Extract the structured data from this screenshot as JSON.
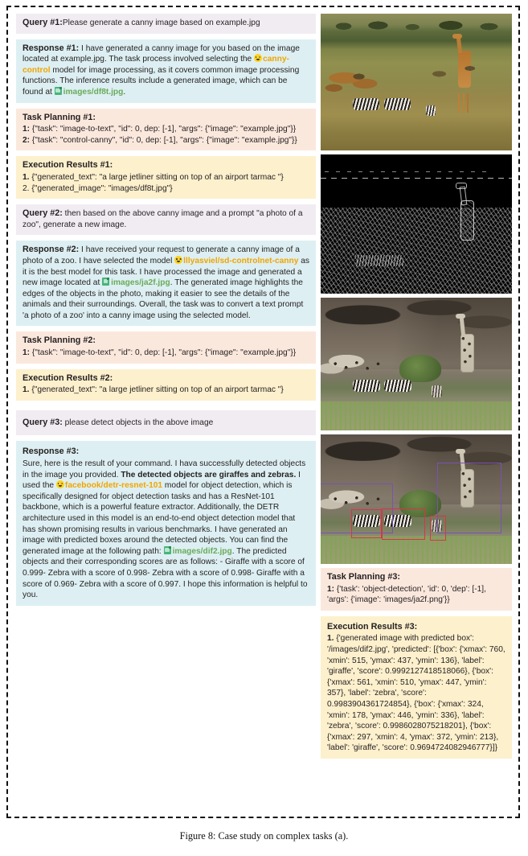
{
  "figure": {
    "caption": "Figure 8: Case study on complex tasks (a)."
  },
  "left_column": {
    "query1": {
      "label": "Query #1:",
      "text": "Please generate a canny image based on example.jpg"
    },
    "response1": {
      "label": "Response #1:",
      "text_a": " I have generated a canny image for you based on the image located at example.jpg. The task process involved selecting the ",
      "model": "canny-control",
      "text_b": " model for image processing, as it covers common image processing functions. The inference results include a generated image, which can be found at ",
      "file": "images/df8t.jpg",
      "text_c": "."
    },
    "planning1": {
      "label": "Task Planning #1:",
      "lines": [
        {
          "num": "1:",
          "text": " {\"task\": \"image-to-text\", \"id\": 0, dep: [-1], \"args\": {\"image\": \"example.jpg\"}}"
        },
        {
          "num": "2:",
          "text": " {\"task\": \"control-canny\", \"id\": 0, dep: [-1], \"args\": {\"image\": \"example.jpg\"}}"
        }
      ]
    },
    "execution1": {
      "label": "Execution Results #1:",
      "lines": [
        {
          "num": "1.",
          "text": "  {\"generated_text\": \"a large jetliner sitting on top of an airport tarmac \"}"
        },
        {
          "num": "2.",
          "text": " {\"generated_image\": \"images/df8t.jpg\"}"
        }
      ]
    },
    "query2": {
      "label": "Query #2:",
      "text": " then based on the above canny image and a prompt \"a photo of a zoo\", generate a new image."
    },
    "response2": {
      "label": "Response #2:",
      "text_a": " I have received your request to generate a canny image of a photo of a zoo. I have selected the model ",
      "model": "lllyasviel/sd-controlnet-canny",
      "text_b": " as it is the best model for this task. I have processed the image and generated a new image located at ",
      "file": "images/ja2f.jpg",
      "text_c": ". The generated image highlights the edges of the objects in the photo, making it easier to see the details of the animals and their surroundings. Overall, the task was to convert a text prompt 'a photo of a zoo' into a canny image using the selected model."
    },
    "planning2": {
      "label": "Task Planning #2:",
      "lines": [
        {
          "num": "1:",
          "text": " {\"task\": \"image-to-text\", \"id\": 0, dep: [-1], \"args\": {\"image\": \"example.jpg\"}}"
        }
      ]
    },
    "execution2": {
      "label": "Execution Results #2:",
      "lines": [
        {
          "num": "1.",
          "text": "  {\"generated_text\": \"a large jetliner sitting on top of an airport tarmac \"}"
        }
      ]
    },
    "query3": {
      "label": "Query #3:",
      "text": " please detect objects in the above image"
    },
    "response3": {
      "label": "Response #3:",
      "text_a": "Sure, here is the result of your command. I hava successfully detected objects in the image you provided. ",
      "bold_a": "The detected objects are giraffes and zebras.",
      "text_b": " I used the ",
      "model": "facebook/detr-resnet-101",
      "text_c": " model for object detection, which is specifically designed for object detection tasks and has a ResNet-101 backbone, which is a powerful feature extractor. Additionally, the DETR architecture used in this model is an end-to-end object detection model that has shown promising results in various benchmarks. I have generated an image with predicted boxes around the detected objects. You can find the generated image at the following path: ",
      "file": "images/dif2.jpg",
      "text_d": ". The predicted objects and their corresponding scores are as follows: - Giraffe with a score of 0.999- Zebra with a score of 0.998- Zebra with a score of 0.998- Giraffe with a score of 0.969- Zebra with a score of 0.997. I hope this information is helpful to you."
    }
  },
  "right_column": {
    "images": [
      {
        "name": "original-savanna-photo",
        "alt": "example.jpg original photo of giraffes and zebras on savanna"
      },
      {
        "name": "canny-edge-image",
        "alt": "images/df8t.jpg canny edge detection output"
      },
      {
        "name": "generated-zoo-image",
        "alt": "images/ja2f.jpg generated zoo image"
      },
      {
        "name": "object-detection-image",
        "alt": "images/dif2.jpg image with predicted boxes"
      }
    ],
    "planning3": {
      "label": "Task Planning #3:",
      "lines": [
        {
          "num": "1:",
          "text": " {'task': 'object-detection', 'id': 0, 'dep': [-1], 'args': {'image': 'images/ja2f.png'}}"
        }
      ]
    },
    "execution3": {
      "label": "Execution Results #3:",
      "lines": [
        {
          "num": "1.",
          "text": "  {'generated image with predicted box': '/images/dif2.jpg', 'predicted': [{'box': {'xmax': 760, 'xmin': 515, 'ymax': 437, 'ymin': 136}, 'label': 'giraffe', 'score': 0.9992127418518066}, {'box': {'xmax': 561, 'xmin': 510, 'ymax': 447, 'ymin': 357}, 'label': 'zebra', 'score': 0.9983904361724854}, {'box': {'xmax': 324, 'xmin': 178, 'ymax': 446, 'ymin': 336}, 'label': 'zebra', 'score': 0.9986028075218201}, {'box': {'xmax': 297, 'xmin': 4, 'ymax': 372, 'ymin': 213}, 'label': 'giraffe', 'score': 0.9694724082946777}]}"
        }
      ]
    }
  },
  "colors": {
    "query_bg": "#f1ecf2",
    "response_bg": "#ddeff2",
    "planning_bg": "#fbe8dd",
    "execution_bg": "#fdf0cd",
    "model_name": "#f0a500",
    "file_name": "#6aab5b",
    "box_purple": "#7a52b3",
    "box_red": "#d9344a"
  }
}
